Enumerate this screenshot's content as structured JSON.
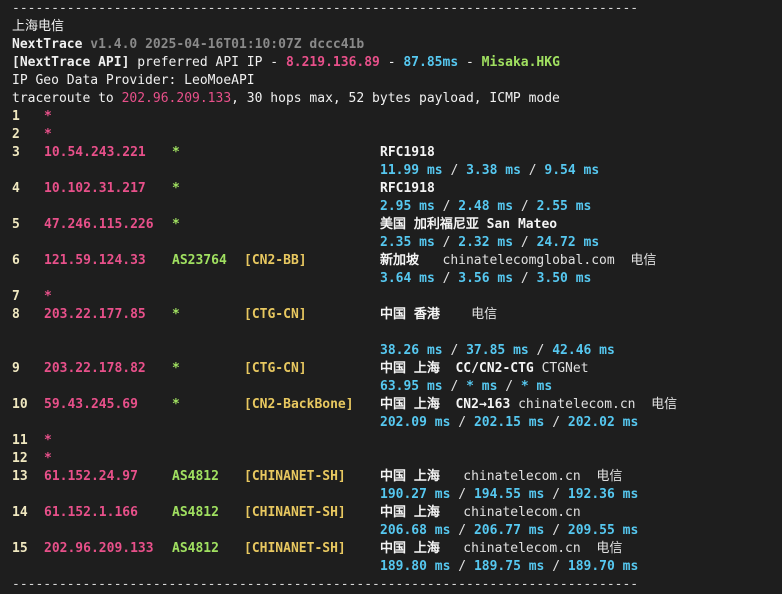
{
  "separator": "--------------------------------------------------------------------------------",
  "header": {
    "location": "上海电信",
    "app_name": "NextTrace",
    "version_info": "v1.4.0 2025-04-16T01:10:07Z dccc41b",
    "api_tag": "[NextTrace API]",
    "api_text": " preferred API IP - ",
    "api_ip": "8.219.136.89",
    "dash1": " - ",
    "api_latency": "87.85ms",
    "dash2": " - ",
    "api_node": "Misaka.HKG",
    "geo_provider": "IP Geo Data Provider: LeoMoeAPI",
    "trace_prefix": "traceroute to ",
    "trace_target": "202.96.209.133",
    "trace_suffix": ", 30 hops max, 52 bytes payload, ICMP mode"
  },
  "hops": [
    {
      "num": "1",
      "ip": "*"
    },
    {
      "num": "2",
      "ip": "*"
    },
    {
      "num": "3",
      "ip": "10.54.243.221",
      "asn": "*",
      "tag": "",
      "geo_strong": "RFC1918",
      "geo_norm": "",
      "rtt": [
        "11.99 ms",
        "3.38 ms",
        "9.54 ms"
      ]
    },
    {
      "num": "4",
      "ip": "10.102.31.217",
      "asn": "*",
      "tag": "",
      "geo_strong": "RFC1918",
      "geo_norm": "",
      "rtt": [
        "2.95 ms",
        "2.48 ms",
        "2.55 ms"
      ]
    },
    {
      "num": "5",
      "ip": "47.246.115.226",
      "asn": "*",
      "tag": "",
      "geo_strong": "美国 加利福尼亚 San Mateo",
      "geo_norm": "",
      "rtt": [
        "2.35 ms",
        "2.32 ms",
        "24.72 ms"
      ]
    },
    {
      "num": "6",
      "ip": "121.59.124.33",
      "asn": "AS23764",
      "tag": "[CN2-BB]",
      "geo_strong": "新加坡",
      "geo_norm": "   chinatelecomglobal.com  电信",
      "rtt": [
        "3.64 ms",
        "3.56 ms",
        "3.50 ms"
      ]
    },
    {
      "num": "7",
      "ip": "*"
    },
    {
      "num": "8",
      "ip": "203.22.177.85",
      "asn": "*",
      "tag": "[CTG-CN]",
      "geo_strong": "中国 香港",
      "geo_norm": "    电信",
      "rtt": [
        "38.26 ms",
        "37.85 ms",
        "42.46 ms"
      ],
      "gap": true
    },
    {
      "num": "9",
      "ip": "203.22.178.82",
      "asn": "*",
      "tag": "[CTG-CN]",
      "geo_strong": "中国 上海  CC/CN2-CTG",
      "geo_norm": " CTGNet",
      "rtt": [
        "63.95 ms",
        "* ms",
        "* ms"
      ]
    },
    {
      "num": "10",
      "ip": "59.43.245.69",
      "asn": "*",
      "tag": "[CN2-BackBone]",
      "geo_strong": "中国 上海  CN2→163",
      "geo_norm": " chinatelecom.cn  电信",
      "rtt": [
        "202.09 ms",
        "202.15 ms",
        "202.02 ms"
      ]
    },
    {
      "num": "11",
      "ip": "*"
    },
    {
      "num": "12",
      "ip": "*"
    },
    {
      "num": "13",
      "ip": "61.152.24.97",
      "asn": "AS4812",
      "tag": "[CHINANET-SH]",
      "geo_strong": "中国 上海",
      "geo_norm": "   chinatelecom.cn  电信",
      "rtt": [
        "190.27 ms",
        "194.55 ms",
        "192.36 ms"
      ]
    },
    {
      "num": "14",
      "ip": "61.152.1.166",
      "asn": "AS4812",
      "tag": "[CHINANET-SH]",
      "geo_strong": "中国 上海",
      "geo_norm": "   chinatelecom.cn",
      "rtt": [
        "206.68 ms",
        "206.77 ms",
        "209.55 ms"
      ]
    },
    {
      "num": "15",
      "ip": "202.96.209.133",
      "asn": "AS4812",
      "tag": "[CHINANET-SH]",
      "geo_strong": "中国 上海",
      "geo_norm": "   chinatelecom.cn  电信",
      "rtt": [
        "189.80 ms",
        "189.75 ms",
        "189.70 ms"
      ]
    }
  ],
  "rtt_separator": " / "
}
